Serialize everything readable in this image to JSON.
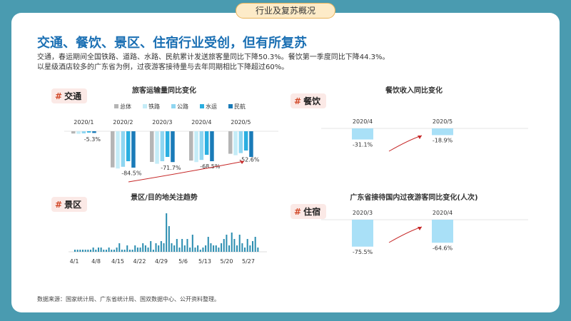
{
  "header": {
    "tag": "行业及复苏概况"
  },
  "main": {
    "title": "交通、餐饮、景区、住宿行业受创，但有所复苏",
    "desc1": "交通，春运期间全国铁路、道路、水路、民航累计发送旅客量同比下降50.3%。餐饮第一季度同比下降44.3%。",
    "desc2": "以星级酒店较多的广东省为例，过夜游客接待量与去年同期相比下降超过60%。"
  },
  "sections": {
    "transport": "交通",
    "scenic": "景区",
    "dining": "餐饮",
    "lodging": "住宿",
    "hash": "#"
  },
  "source": "数据来源：国家统计局、广东省统计局、国双数据中心、公开资料整理。",
  "colors": {
    "total": "#b5b5b5",
    "rail": "#c4ecf7",
    "road": "#8fd6f1",
    "water": "#2aaee0",
    "air": "#1a7bb8",
    "bar_single": "#a9e0f7",
    "trend": "#2a8db0",
    "arrow": "#c62828"
  },
  "chart_data": [
    {
      "type": "bar",
      "title": "旅客运输量同比变化",
      "categories": [
        "2020/1",
        "2020/2",
        "2020/3",
        "2020/4",
        "2020/5"
      ],
      "series": [
        {
          "name": "总体",
          "values": [
            -5.3,
            -84.5,
            -71.7,
            -68.5,
            -52.6
          ]
        },
        {
          "name": "铁路",
          "values": [
            -6,
            -87,
            -76,
            -72,
            -56
          ]
        },
        {
          "name": "公路",
          "values": [
            -5,
            -83,
            -70,
            -67,
            -51
          ]
        },
        {
          "name": "水运",
          "values": [
            -3,
            -70,
            -60,
            -55,
            -45
          ]
        },
        {
          "name": "民航",
          "values": [
            -4,
            -85,
            -72,
            -70,
            -60
          ]
        }
      ],
      "labels": [
        "-5.3%",
        "-84.5%",
        "-71.7%",
        "-68.5%",
        "-52.6%"
      ],
      "ylim": [
        -100,
        0
      ]
    },
    {
      "type": "bar",
      "title": "餐饮收入同比变化",
      "categories": [
        "2020/4",
        "2020/5"
      ],
      "values": [
        -31.1,
        -18.9
      ],
      "labels": [
        "-31.1%",
        "-18.9%"
      ],
      "ylim": [
        -80,
        0
      ]
    },
    {
      "type": "bar",
      "title": "景区/目的地关注趋势",
      "categories": [
        "4/1",
        "4/8",
        "4/15",
        "4/22",
        "4/29",
        "5/6",
        "5/13",
        "5/20",
        "5/27"
      ],
      "values": [
        1,
        1,
        1,
        1,
        1,
        1,
        1,
        2,
        1,
        2,
        2,
        1,
        1,
        2,
        1,
        1,
        2,
        4,
        1,
        1,
        3,
        1,
        1,
        3,
        2,
        2,
        4,
        3,
        2,
        5,
        1,
        4,
        3,
        5,
        4,
        18,
        12,
        4,
        3,
        6,
        2,
        6,
        3,
        6,
        2,
        8,
        2,
        3,
        1,
        2,
        3,
        7,
        4,
        3,
        3,
        2,
        4,
        6,
        8,
        3,
        9,
        6,
        3,
        8,
        4,
        2,
        6,
        3,
        5,
        7,
        2
      ],
      "ylim": [
        0,
        20
      ]
    },
    {
      "type": "bar",
      "title": "广东省接待国内过夜游客同比变化(人次)",
      "categories": [
        "2020/3",
        "2020/4"
      ],
      "values": [
        -75.5,
        -64.6
      ],
      "labels": [
        "-75.5%",
        "-64.6%"
      ],
      "ylim": [
        -80,
        0
      ]
    }
  ]
}
